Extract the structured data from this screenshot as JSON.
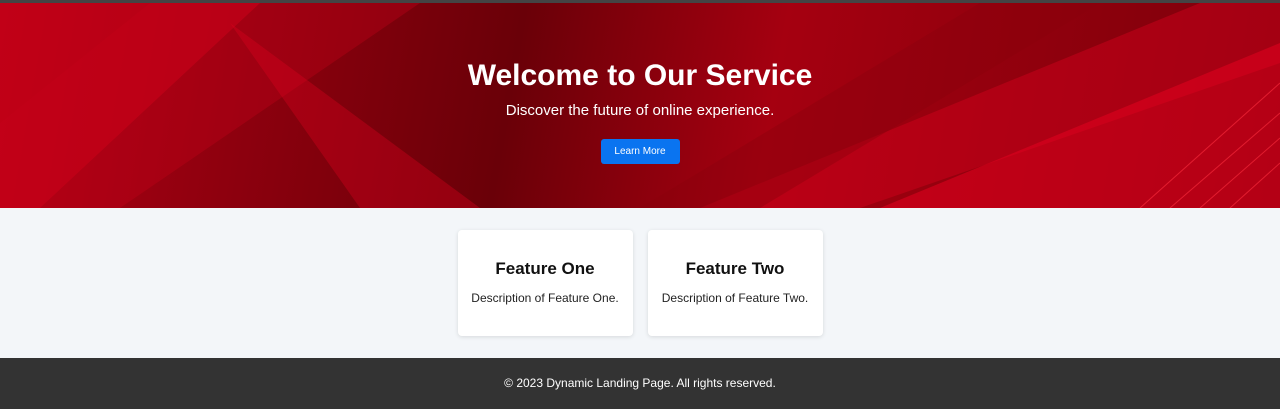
{
  "hero": {
    "title": "Welcome to Our Service",
    "subtitle": "Discover the future of online experience.",
    "button_label": "Learn More"
  },
  "features": [
    {
      "title": "Feature One",
      "description": "Description of Feature One."
    },
    {
      "title": "Feature Two",
      "description": "Description of Feature Two."
    }
  ],
  "footer": {
    "text": "© 2023 Dynamic Landing Page. All rights reserved."
  },
  "colors": {
    "hero_red": "#a50010",
    "button_blue": "#0a74f0",
    "page_bg": "#f3f6f9",
    "footer_bg": "#333333"
  }
}
